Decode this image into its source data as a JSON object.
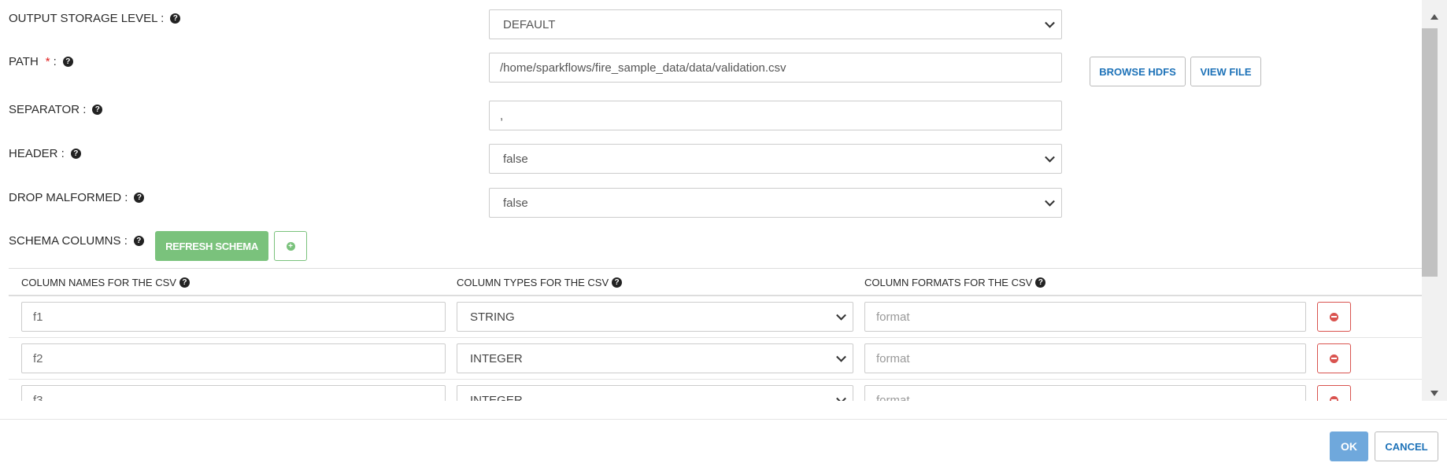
{
  "fields": {
    "storage_level": {
      "label": "OUTPUT STORAGE LEVEL :",
      "value": "DEFAULT"
    },
    "path": {
      "label": "PATH",
      "required_mark": "*",
      "colon": ":",
      "value": "/home/sparkflows/fire_sample_data/data/validation.csv"
    },
    "separator": {
      "label": "SEPARATOR :",
      "value": ","
    },
    "header": {
      "label": "HEADER :",
      "value": "false"
    },
    "drop_malformed": {
      "label": "DROP MALFORMED :",
      "value": "false"
    },
    "schema_columns": {
      "label": "SCHEMA COLUMNS :"
    }
  },
  "buttons": {
    "browse_hdfs": "BROWSE HDFS",
    "view_file": "VIEW FILE",
    "refresh_schema": "REFRESH SCHEMA",
    "ok": "OK",
    "cancel": "CANCEL"
  },
  "icons": {
    "help": "?",
    "add": "+"
  },
  "table": {
    "headers": [
      "COLUMN NAMES FOR THE CSV",
      "COLUMN TYPES FOR THE CSV",
      "COLUMN FORMATS FOR THE CSV"
    ],
    "format_placeholder": "format",
    "rows": [
      {
        "name": "f1",
        "type": "STRING"
      },
      {
        "name": "f2",
        "type": "INTEGER"
      },
      {
        "name": "f3",
        "type": "INTEGER"
      }
    ]
  },
  "colors": {
    "primary": "#6fa8dc",
    "link": "#1d72b8",
    "success": "#7ac27c",
    "danger": "#d9534f"
  }
}
